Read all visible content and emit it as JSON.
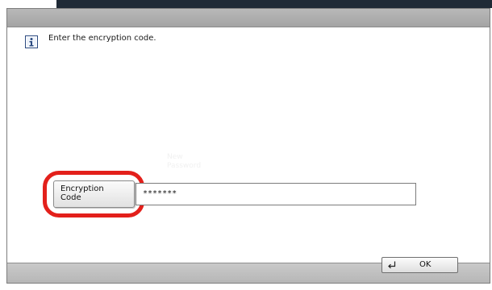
{
  "dialog": {
    "message": "Enter the encryption code.",
    "faded_hint": [
      "New",
      "Password"
    ]
  },
  "encryption_code": {
    "button_lines": [
      "Encryption",
      "Code"
    ],
    "value": "*******"
  },
  "footer": {
    "ok_label": "OK"
  },
  "icons": {
    "info": "info-icon",
    "enter": "enter-icon"
  },
  "colors": {
    "highlight": "#e3201b",
    "icon_border": "#2b4a80"
  }
}
